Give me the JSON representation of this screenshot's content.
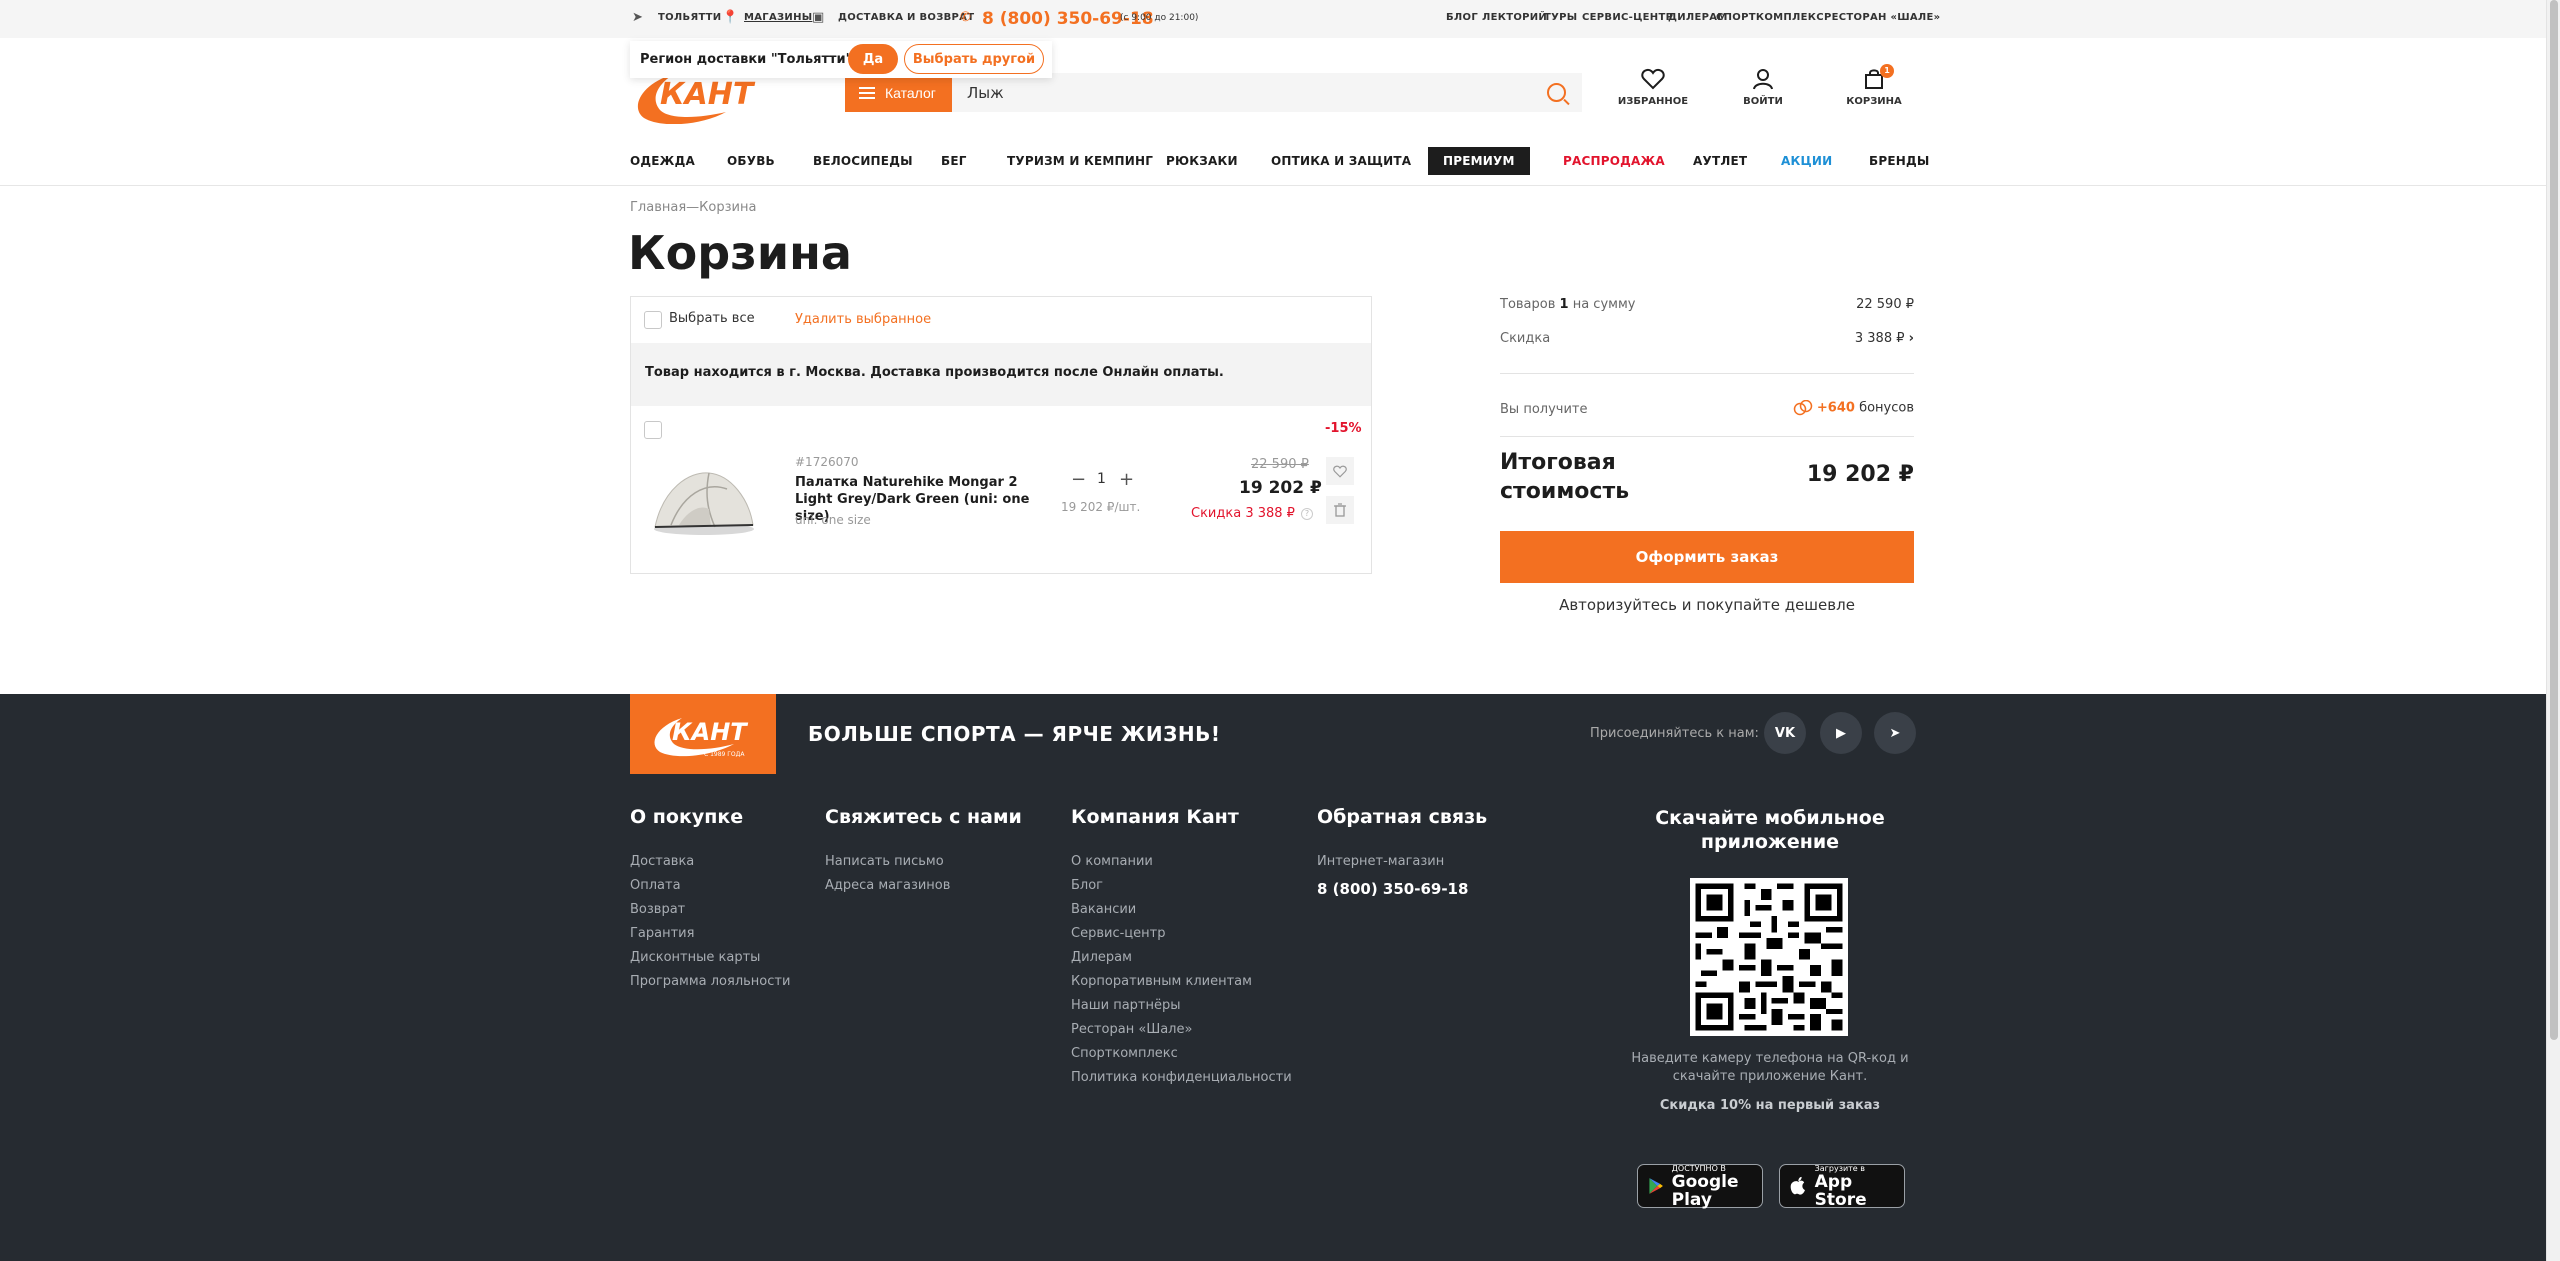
{
  "topbar": {
    "city": "ТОЛЬЯТТИ",
    "stores": "МАГАЗИНЫ",
    "delivery": "ДОСТАВКА И ВОЗВРАТ",
    "phone": "8 (800) 350-69-18",
    "hours": "(с 9:00 до 21:00)",
    "links": [
      "БЛОГ",
      "ЛЕКТОРИЙ",
      "ТУРЫ",
      "СЕРВИС-ЦЕНТР",
      "ДИЛЕРАМ",
      "СПОРТКОМПЛЕКС",
      "РЕСТОРАН «ШАЛЕ»"
    ]
  },
  "region_popup": {
    "question": "Регион доставки \"Тольятти\" ?",
    "yes": "Да",
    "choose_other": "Выбрать другой"
  },
  "header": {
    "logo_text": "КАНТ",
    "catalog": "Каталог",
    "search_value": "Лыж",
    "favorites": "ИЗБРАННОЕ",
    "login": "ВОЙТИ",
    "cart": "КОРЗИНА",
    "cart_count": "1"
  },
  "nav": [
    "ОДЕЖДА",
    "ОБУВЬ",
    "ВЕЛОСИПЕДЫ",
    "БЕГ",
    "ТУРИЗМ И КЕМПИНГ",
    "РЮКЗАКИ",
    "ОПТИКА И ЗАЩИТА",
    "ПРЕМИУМ",
    "РАСПРОДАЖА",
    "АУТЛЕТ",
    "АКЦИИ",
    "БРЕНДЫ"
  ],
  "breadcrumb": "Главная—Корзина",
  "page_title": "Корзина",
  "cart": {
    "select_all": "Выбрать все",
    "delete_selected": "Удалить выбранное",
    "notice": "Товар находится в г. Москва. Доставка производится после Онлайн оплаты.",
    "item": {
      "discount": "-15%",
      "sku": "#1726070",
      "name": "Палатка Naturehike Mongar 2 Light Grey/Dark Green (uni: one size)",
      "size": "uni: one size",
      "qty": "1",
      "unit_price": "19 202 ₽/шт.",
      "old_price": "22 590 ₽",
      "price": "19 202 ₽",
      "discount_amount": "Скидка 3 388 ₽",
      "help": "?"
    }
  },
  "summary": {
    "items_label_pre": "Товаров ",
    "items_count": "1",
    "items_label_post": " на сумму",
    "items_sum": "22 590 ₽",
    "discount_label": "Скидка",
    "discount_val": "3 388 ₽",
    "bonus_label": "Вы получите",
    "bonus_val": "+640",
    "bonus_word": "бонусов",
    "total_label": "Итоговая стоимость",
    "total_val": "19 202 ₽",
    "order_btn": "Оформить заказ",
    "login_cheaper": "Авторизуйтесь и покупайте дешевле"
  },
  "footer": {
    "logo_text": "КАНТ",
    "logo_sub": "С 1989 ГОДА",
    "slogan": "БОЛЬШЕ СПОРТА — ЯРЧЕ ЖИЗНЬ!",
    "join": "Присоединяйтесь к нам:",
    "socials": [
      "VK",
      "▶",
      "➤"
    ],
    "col1": {
      "title": "О покупке",
      "links": [
        "Доставка",
        "Оплата",
        "Возврат",
        "Гарантия",
        "Дисконтные карты",
        "Программа лояльности"
      ]
    },
    "col2": {
      "title": "Свяжитесь с нами",
      "links": [
        "Написать письмо",
        "Адреса магазинов"
      ]
    },
    "col3": {
      "title": "Компания Кант",
      "links": [
        "О компании",
        "Блог",
        "Вакансии",
        "Сервис-центр",
        "Дилерам",
        "Корпоративным клиентам",
        "Наши партнёры",
        "Ресторан «Шале»",
        "Спорткомплекс",
        "Политика конфиденциальности"
      ]
    },
    "col4": {
      "title": "Обратная связь",
      "shop_label": "Интернет-магазин",
      "phone": "8 (800) 350-69-18"
    },
    "app": {
      "title": "Скачайте мобильное приложение",
      "qr_text": "Наведите камеру телефона на QR-код и скачайте приложение Кант.",
      "promo": "Скидка 10% на первый заказ",
      "gp_small": "ДОСТУПНО В",
      "gp_big": "Google Play",
      "as_small": "Загрузите в",
      "as_big": "App Store"
    }
  },
  "colors": {
    "accent": "#f37021",
    "sale": "#e2142d",
    "footer_bg": "#262b31"
  }
}
